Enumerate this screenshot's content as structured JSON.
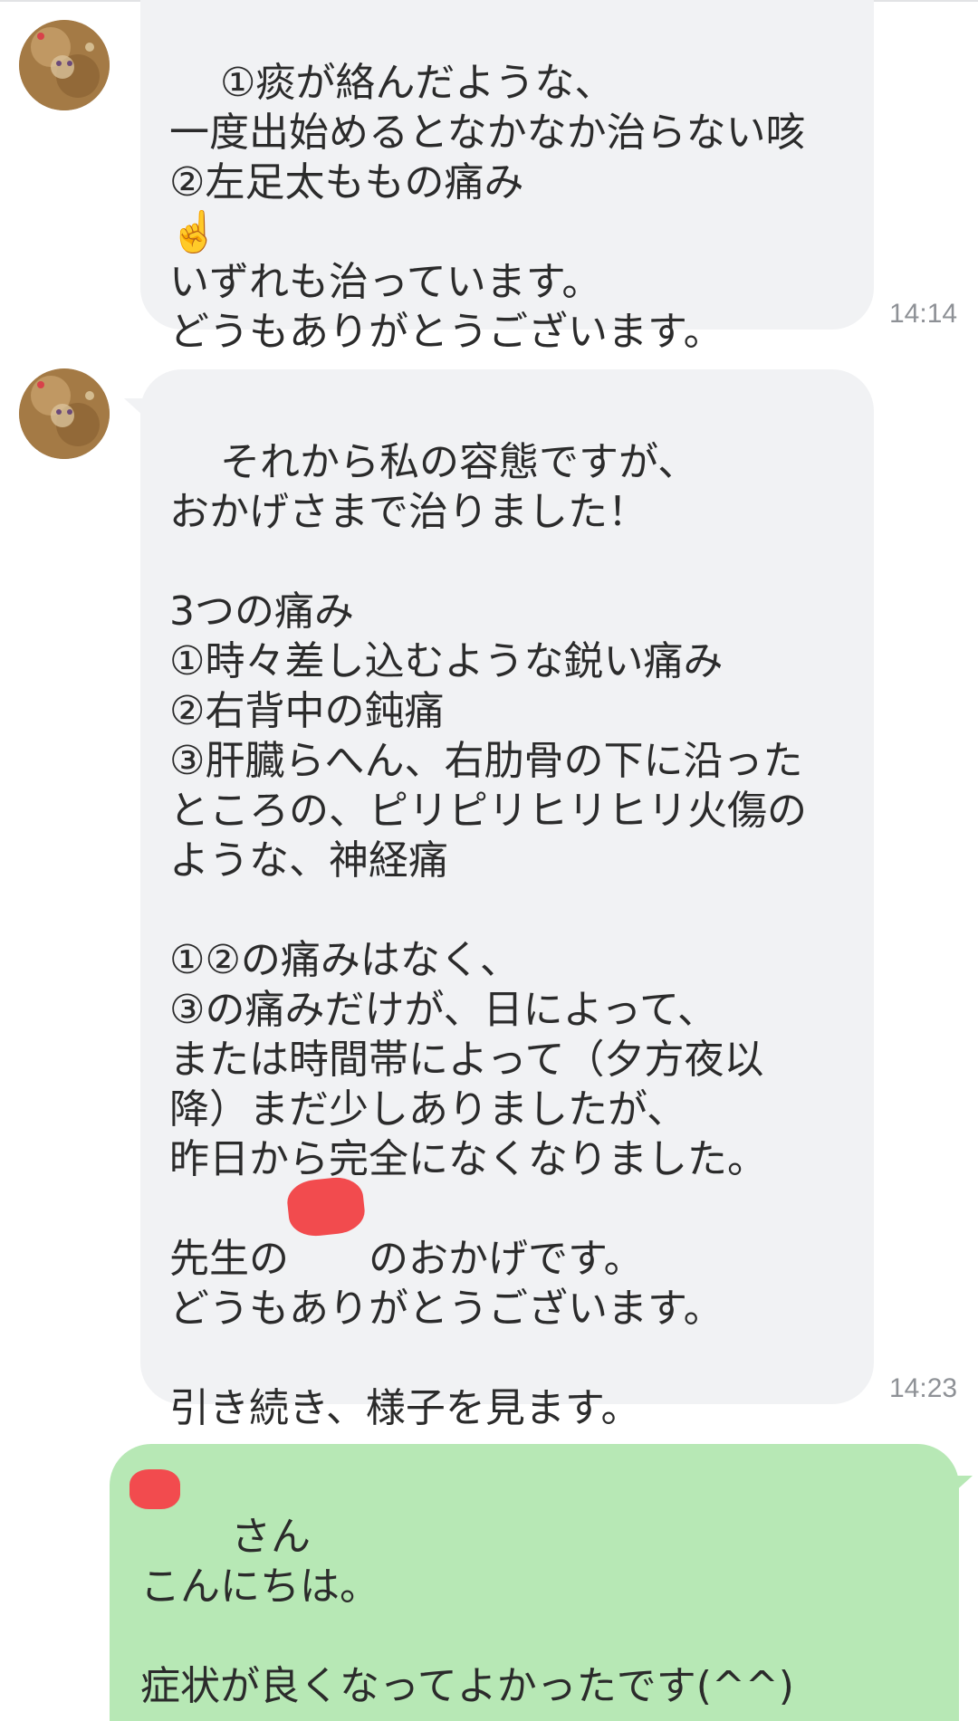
{
  "messages": [
    {
      "direction": "incoming",
      "text": "①痰が絡んだような、\n一度出始めるとなかなか治らない咳\n②左足太ももの痛み\n☝️\nいずれも治っています。\nどうもありがとうございます。",
      "time": "14:14"
    },
    {
      "direction": "incoming",
      "text": "それから私の容態ですが、\nおかげさまで治りました！\n\n3つの痛み\n①時々差し込むような鋭い痛み\n②右背中の鈍痛\n③肝臓らへん、右肋骨の下に沿った\nところの、ピリピリヒリヒリ火傷の\nような、神経痛\n\n①②の痛みはなく、\n③の痛みだけが、日によって、\nまたは時間帯によって（夕方夜以\n降）まだ少しありましたが、\n昨日から完全になくなりました。\n\n先生の　　のおかげです。\nどうもありがとうございます。\n\n引き続き、様子を見ます。",
      "time": "14:23"
    },
    {
      "direction": "outgoing",
      "text": "　さん\nこんにちは。\n\n症状が良くなってよかったです(^^)",
      "time": ""
    }
  ],
  "colors": {
    "incoming_bubble": "#f1f2f4",
    "outgoing_bubble": "#b7e8b5",
    "timestamp": "#8e9196",
    "redaction": "#f24b4e"
  }
}
